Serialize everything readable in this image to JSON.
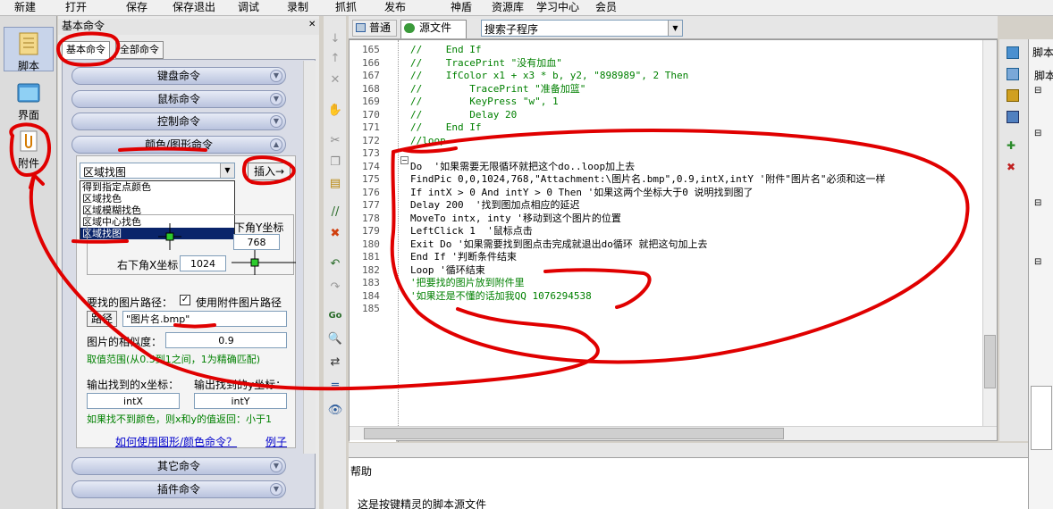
{
  "menubar": {
    "items": [
      "新建",
      "打开",
      "保存",
      "保存退出",
      "调试",
      "录制",
      "抓抓",
      "发布",
      "神盾",
      "资源库",
      "学习中心",
      "会员"
    ]
  },
  "sidebar": {
    "items": [
      {
        "label": "脚本",
        "icon": "script-icon"
      },
      {
        "label": "界面",
        "icon": "window-icon"
      },
      {
        "label": "附件",
        "icon": "attachment-icon"
      }
    ]
  },
  "panel": {
    "title": "基本命令",
    "tabs": [
      "基本命令",
      "全部命令"
    ],
    "categories": {
      "keyboard": "键盘命令",
      "mouse": "鼠标命令",
      "control": "控制命令",
      "color_image": "颜色/图形命令",
      "other": "其它命令",
      "plugin": "插件命令"
    },
    "command_select": "区域找图",
    "insert_button": "插入→",
    "dropdown_options": [
      "得到指定点颜色",
      "区域找色",
      "区域模糊找色",
      "区域中心找色",
      "区域找图"
    ],
    "bottom_right_y_label": "下角Y坐标",
    "bottom_right_y_value": "768",
    "bottom_right_x_label": "右下角X坐标",
    "bottom_right_x_value": "1024",
    "image_path_label": "要找的图片路径：",
    "use_attachment_label": "使用附件图片路径",
    "use_attachment_checked": true,
    "path_button": "路径",
    "path_value": "\"图片名.bmp\"",
    "similarity_label": "图片的相似度：",
    "similarity_value": "0.9",
    "similarity_hint": "取值范围(从0.5到1之间，1为精确匹配)",
    "output_x_label": "输出找到的x坐标：",
    "output_y_label": "输出找到的y坐标：",
    "output_x_value": "intX",
    "output_y_value": "intY",
    "not_found_hint": "如果找不到颜色，则x和y的值返回：小于1",
    "help_link": "如何使用图形/颜色命令？",
    "example_link": "例子"
  },
  "editor": {
    "view_tabs": [
      "普通",
      "源文件"
    ],
    "search_placeholder": "搜索子程序",
    "line_numbers": [
      "165",
      "166",
      "167",
      "168",
      "169",
      "170",
      "171",
      "172",
      "173",
      "174",
      "175",
      "176",
      "177",
      "178",
      "179",
      "180",
      "181",
      "182",
      "183",
      "184",
      "185"
    ],
    "lines": [
      "//    End If",
      "//    TracePrint \"没有加血\"",
      "//    IfColor x1 + x3 * b, y2, \"898989\", 2 Then",
      "//        TracePrint \"准备加篮\"",
      "//        KeyPress \"w\", 1",
      "//        Delay 20",
      "//    End If",
      "//loop",
      "",
      "Do  '如果需要无限循环就把这个do..loop加上去",
      "FindPic 0,0,1024,768,\"Attachment:\\图片名.bmp\",0.9,intX,intY '附件\"图片名\"必须和这一样",
      "If intX > 0 And intY > 0 Then '如果这两个坐标大于0 说明找到图了",
      "Delay 200  '找到图加点相应的延迟",
      "MoveTo intx, inty '移动到这个图片的位置",
      "LeftClick 1  '鼠标点击",
      "Exit Do '如果需要找到图点击完成就退出do循环 就把这句加上去",
      "End If '判断条件结束",
      "Loop '循环结束",
      "'把要找的图片放到附件里",
      "'如果还是不懂的话加我QQ 1076294538",
      ""
    ]
  },
  "help": {
    "title": "帮助",
    "text": "这是按键精灵的脚本源文件"
  },
  "right_panel": {
    "title": "脚本",
    "subtitle": "脚本"
  },
  "colors": {
    "annotation_red": "#e00000",
    "accent_blue": "#0a246a",
    "comment_green": "#008000"
  }
}
